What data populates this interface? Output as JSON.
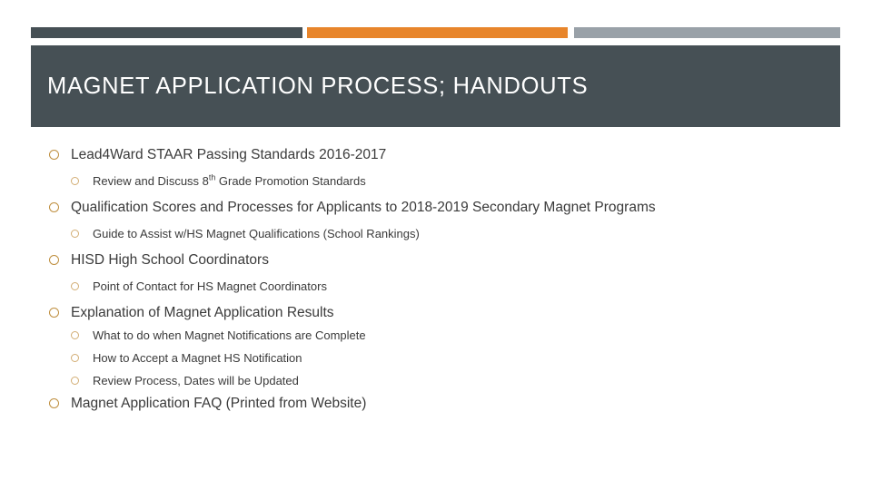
{
  "slide": {
    "title": "MAGNET APPLICATION PROCESS; HANDOUTS",
    "colors": {
      "banner_bg": "#465055",
      "accent_dark": "#465055",
      "accent_orange": "#E8852B",
      "accent_gray": "#99A1A8",
      "bullet_level1": "#BF8F3F",
      "bullet_level2": "#D2AD73",
      "body_text": "#3A3A3A",
      "title_text": "#FFFFFF",
      "background": "#FFFFFF"
    },
    "bullets": [
      {
        "level": 1,
        "text": "Lead4Ward STAAR Passing Standards 2016-2017"
      },
      {
        "level": 2,
        "text_before_sup": "Review and Discuss 8",
        "superscript": "th",
        "text_after_sup": " Grade Promotion Standards",
        "text": "Review and Discuss 8th Grade Promotion Standards"
      },
      {
        "level": 1,
        "text": "Qualification Scores and Processes for Applicants to 2018-2019 Secondary Magnet Programs"
      },
      {
        "level": 2,
        "text": "Guide to Assist w/HS Magnet Qualifications (School Rankings)"
      },
      {
        "level": 1,
        "text": "HISD High School Coordinators"
      },
      {
        "level": 2,
        "text": "Point of Contact for HS Magnet Coordinators"
      },
      {
        "level": 1,
        "text": "Explanation of Magnet Application Results"
      },
      {
        "level": 2,
        "text": "What to do when Magnet Notifications are Complete"
      },
      {
        "level": 2,
        "text": "How to Accept a Magnet HS Notification"
      },
      {
        "level": 2,
        "text": "Review Process, Dates will be Updated"
      },
      {
        "level": 1,
        "text": "Magnet Application FAQ (Printed from Website)"
      }
    ]
  }
}
